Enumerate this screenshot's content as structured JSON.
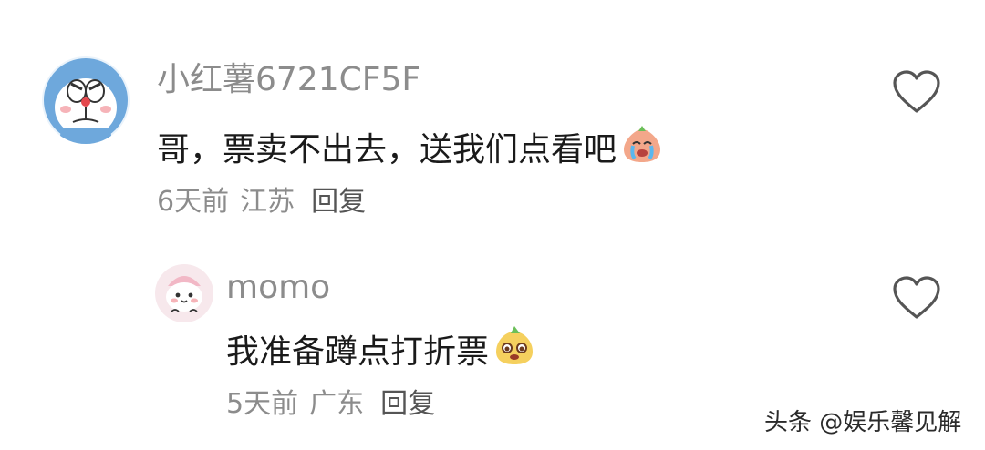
{
  "comments": [
    {
      "username": "小红薯6721CF5F",
      "text": "哥，票卖不出去，送我们点看吧",
      "emoji": "crying-face-icon",
      "time": "6天前",
      "location": "江苏",
      "reply_label": "回复"
    },
    {
      "username": "momo",
      "text": "我准备蹲点打折票",
      "emoji": "smug-face-icon",
      "time": "5天前",
      "location": "广东",
      "reply_label": "回复"
    }
  ],
  "watermark": "头条 @娱乐馨见解",
  "colors": {
    "meta_text": "#8c8c8c",
    "body_text": "#1a1a1a",
    "avatar1_bg": "#6ea8dc",
    "avatar2_bg": "#f7e8ec"
  }
}
